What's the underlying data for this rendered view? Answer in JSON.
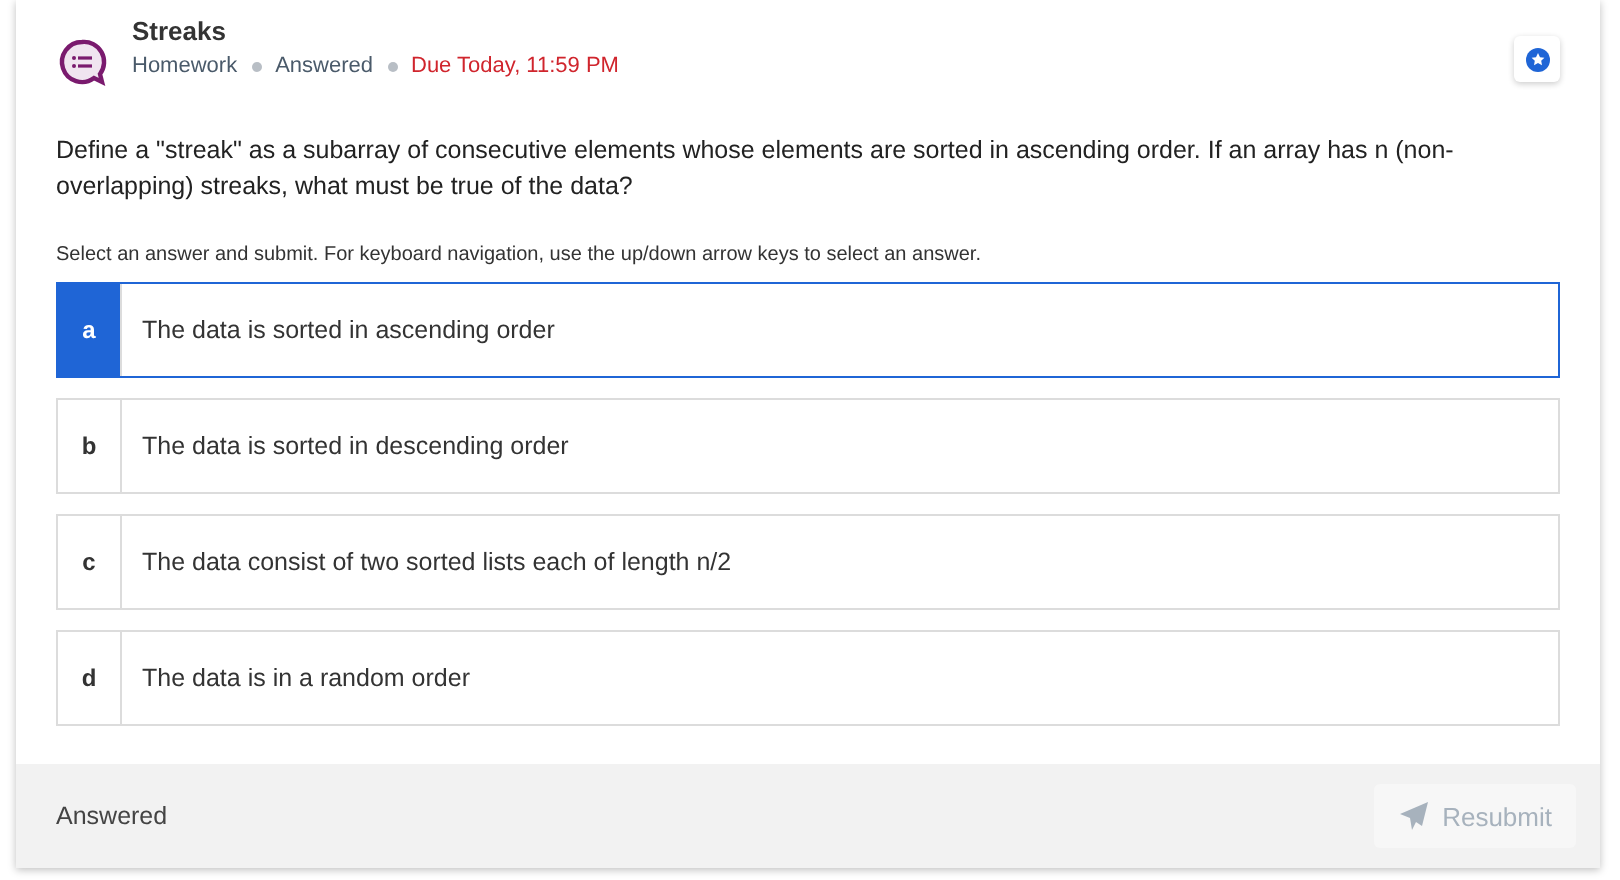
{
  "header": {
    "title": "Streaks",
    "meta": [
      {
        "text": "Homework",
        "kind": "plain"
      },
      {
        "text": "Answered",
        "kind": "plain"
      },
      {
        "text": "Due Today, 11:59 PM",
        "kind": "due"
      }
    ]
  },
  "question": "Define a \"streak\" as a subarray of consecutive elements whose elements are sorted in ascending order. If an array has n (non-overlapping) streaks, what must be true of the data?",
  "instructions": "Select an answer and submit. For keyboard navigation, use the up/down arrow keys to select an answer.",
  "options": [
    {
      "letter": "a",
      "text": "The data is sorted in ascending order",
      "selected": true
    },
    {
      "letter": "b",
      "text": "The data is sorted in descending order",
      "selected": false
    },
    {
      "letter": "c",
      "text": "The data consist of two sorted lists each of length n/2",
      "selected": false
    },
    {
      "letter": "d",
      "text": "The data is in a random order",
      "selected": false
    }
  ],
  "footer": {
    "status": "Answered",
    "button": {
      "label": "Resubmit",
      "disabled": true
    }
  }
}
